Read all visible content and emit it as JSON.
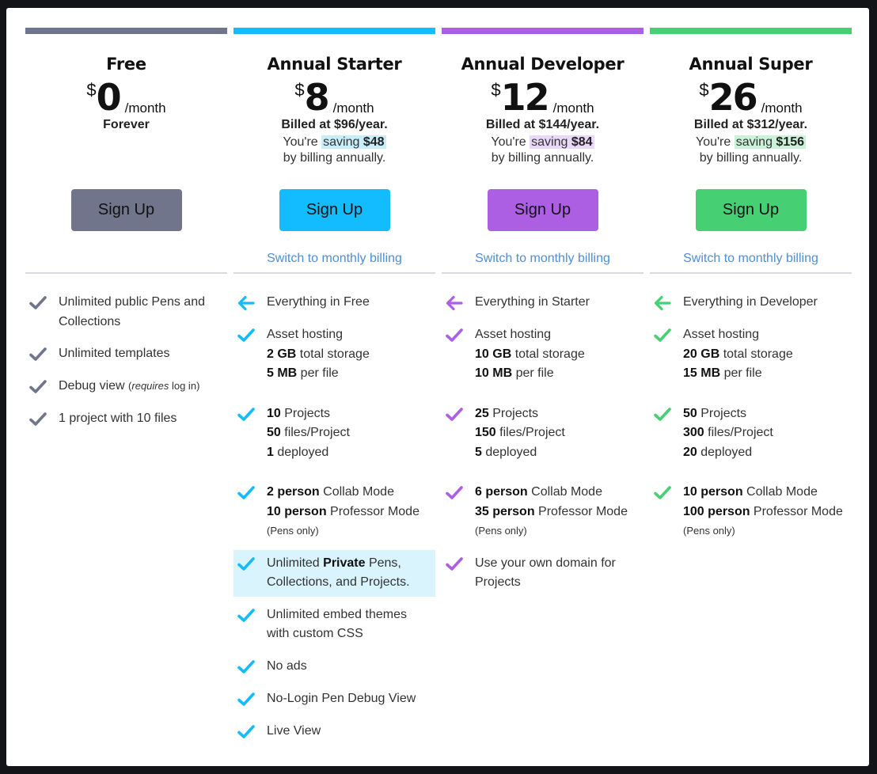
{
  "colors": {
    "free": "#70758c",
    "starter": "#12bcfe",
    "developer": "#ad5fe3",
    "super": "#47cf73",
    "starter_saving_bg": "#c8eefc",
    "developer_saving_bg": "#ead8fa",
    "super_saving_bg": "#cbf2d8",
    "link": "#4f8ed1"
  },
  "plans": [
    {
      "name": "Free",
      "currency": "$",
      "amount": "0",
      "per": "/month",
      "forever": "Forever",
      "signup": "Sign Up",
      "features": [
        {
          "icon": "check",
          "text": "Unlimited public Pens and Collections"
        },
        {
          "icon": "check",
          "text": "Unlimited templates"
        },
        {
          "icon": "check",
          "pre": "Debug view ",
          "note_italic": "requires",
          "note": " log in"
        },
        {
          "icon": "check",
          "text": "1 project with 10 files"
        }
      ]
    },
    {
      "name": "Annual Starter",
      "currency": "$",
      "amount": "8",
      "per": "/month",
      "billed": "Billed at $96/year.",
      "saving_pre": "You're ",
      "saving_word": "saving ",
      "saving_amt": "$48",
      "saving_post": "by billing annually.",
      "signup": "Sign Up",
      "switch": "Switch to monthly billing",
      "features": [
        {
          "icon": "arrow",
          "text": "Everything in Free"
        },
        {
          "icon": "check",
          "l1": "Asset hosting",
          "l2b": "2 GB",
          "l2": " total storage",
          "l3b": "5 MB",
          "l3": " per file"
        },
        {
          "icon": "check",
          "l1b": "10",
          "l1": " Projects",
          "l2b": "50",
          "l2": " files/Project",
          "l3b": "1",
          "l3": " deployed"
        },
        {
          "icon": "check",
          "l1b": "2 person",
          "l1": " Collab Mode",
          "l2b": "10 person",
          "l2": " Professor Mode",
          "note": "(Pens only)"
        },
        {
          "icon": "check",
          "pre": "Unlimited ",
          "bold": "Private",
          "post": " Pens, Collections, and Projects.",
          "highlight": true
        },
        {
          "icon": "check",
          "text": "Unlimited embed themes with custom CSS"
        },
        {
          "icon": "check",
          "text": "No ads"
        },
        {
          "icon": "check",
          "text": "No-Login Pen Debug View"
        },
        {
          "icon": "check",
          "text": "Live View"
        }
      ]
    },
    {
      "name": "Annual Developer",
      "currency": "$",
      "amount": "12",
      "per": "/month",
      "billed": "Billed at $144/year.",
      "saving_pre": "You're ",
      "saving_word": "saving ",
      "saving_amt": "$84",
      "saving_post": "by billing annually.",
      "signup": "Sign Up",
      "switch": "Switch to monthly billing",
      "features": [
        {
          "icon": "arrow",
          "text": "Everything in Starter"
        },
        {
          "icon": "check",
          "l1": "Asset hosting",
          "l2b": "10 GB",
          "l2": " total storage",
          "l3b": "10 MB",
          "l3": " per file"
        },
        {
          "icon": "check",
          "l1b": "25",
          "l1": " Projects",
          "l2b": "150",
          "l2": " files/Project",
          "l3b": "5",
          "l3": " deployed"
        },
        {
          "icon": "check",
          "l1b": "6 person",
          "l1": " Collab Mode",
          "l2b": "35 person",
          "l2": " Professor Mode",
          "note": "(Pens only)"
        },
        {
          "icon": "check",
          "text": "Use your own domain for Projects"
        }
      ]
    },
    {
      "name": "Annual Super",
      "currency": "$",
      "amount": "26",
      "per": "/month",
      "billed": "Billed at $312/year.",
      "saving_pre": "You're ",
      "saving_word": "saving ",
      "saving_amt": "$156",
      "saving_post": "by billing annually.",
      "signup": "Sign Up",
      "switch": "Switch to monthly billing",
      "features": [
        {
          "icon": "arrow",
          "text": "Everything in Developer"
        },
        {
          "icon": "check",
          "l1": "Asset hosting",
          "l2b": "20 GB",
          "l2": " total storage",
          "l3b": "15 MB",
          "l3": " per file"
        },
        {
          "icon": "check",
          "l1b": "50",
          "l1": " Projects",
          "l2b": "300",
          "l2": " files/Project",
          "l3b": "20",
          "l3": " deployed"
        },
        {
          "icon": "check",
          "l1b": "10 person",
          "l1": " Collab Mode",
          "l2b": "100 person",
          "l2": " Professor Mode",
          "note": "(Pens only)"
        }
      ]
    }
  ]
}
